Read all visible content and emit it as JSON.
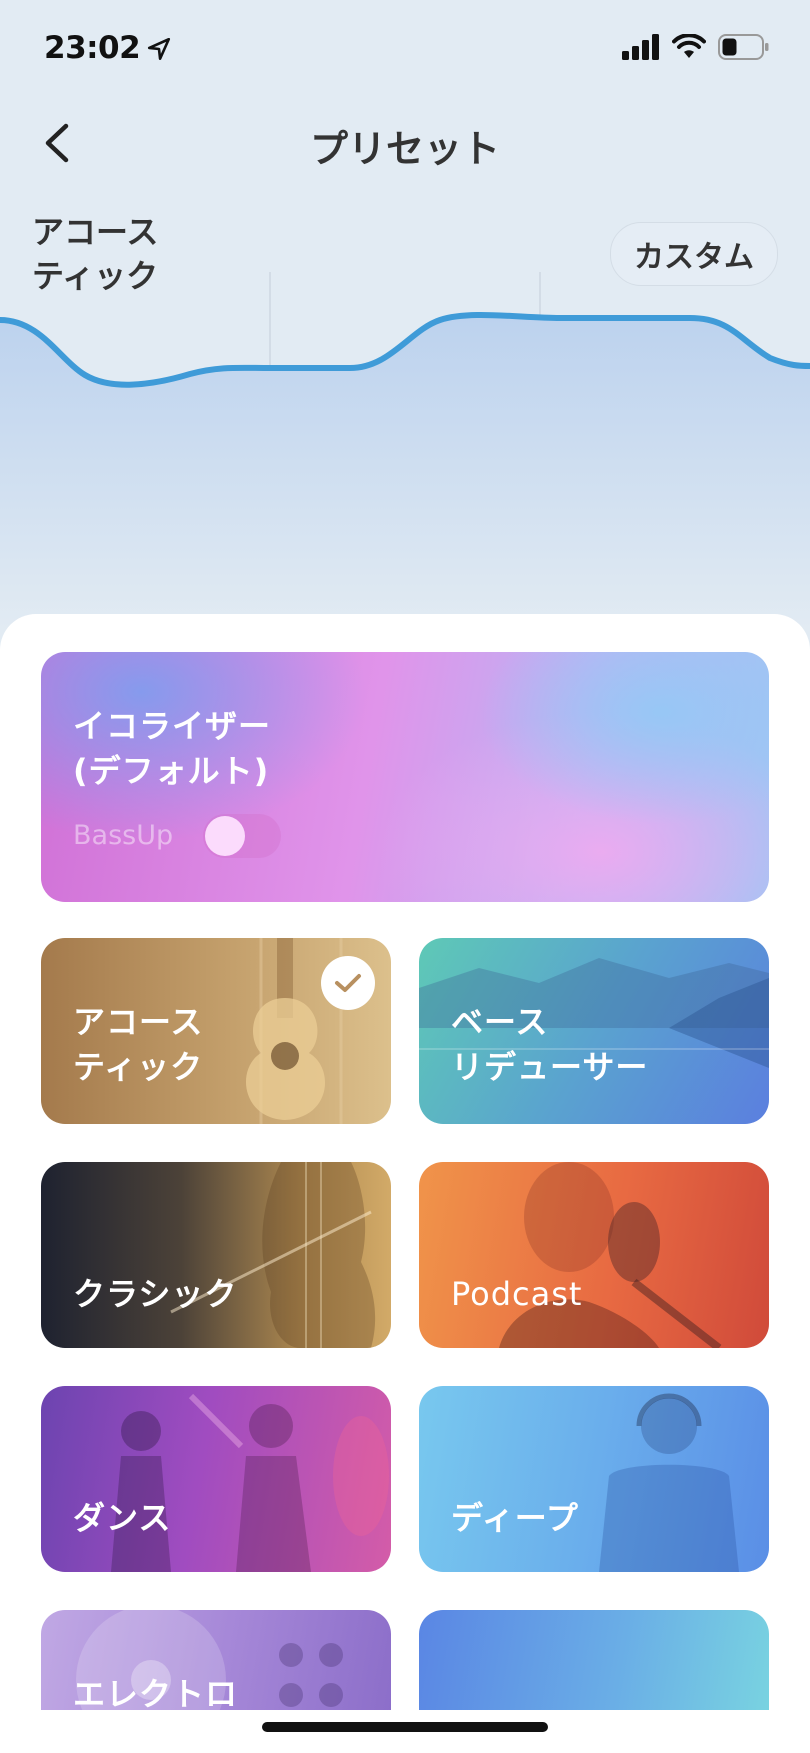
{
  "status_bar": {
    "time": "23:02",
    "icons": [
      "location-arrow-icon",
      "cellular-signal-icon",
      "wifi-icon",
      "battery-icon"
    ]
  },
  "nav": {
    "title": "プリセット",
    "back_icon": "chevron-left-icon"
  },
  "equalizer": {
    "current_preset": "アコース\nティック",
    "custom_button": "カスタム",
    "curve_color": "#3f9bd8"
  },
  "presets": {
    "default_card": {
      "title": "イコライザー\n(デフォルト)",
      "toggle_label": "BassUp",
      "toggle_on": false
    },
    "items": [
      {
        "title": "アコース\nティック",
        "selected": true
      },
      {
        "title": "ベース\nリデューサー",
        "selected": false
      },
      {
        "title": "クラシック",
        "selected": false
      },
      {
        "title": "Podcast",
        "selected": false
      },
      {
        "title": "ダンス",
        "selected": false
      },
      {
        "title": "ディープ",
        "selected": false
      },
      {
        "title": "エレクトロ",
        "selected": false
      },
      {
        "title": "",
        "selected": false
      }
    ]
  }
}
